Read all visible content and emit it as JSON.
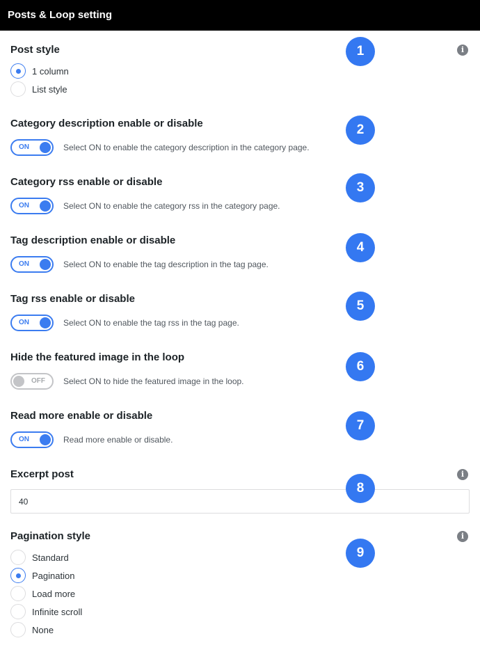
{
  "header": {
    "title": "Posts & Loop setting"
  },
  "info_icon_glyph": "i",
  "post_style": {
    "title": "Post style",
    "badge": "1",
    "options": [
      {
        "label": "1 column",
        "checked": true
      },
      {
        "label": "List style",
        "checked": false
      }
    ]
  },
  "category_description": {
    "title": "Category description enable or disable",
    "badge": "2",
    "toggle": "ON",
    "description": "Select ON to enable the category description in the category page."
  },
  "category_rss": {
    "title": "Category rss enable or disable",
    "badge": "3",
    "toggle": "ON",
    "description": "Select ON to enable the category rss in the category page."
  },
  "tag_description": {
    "title": "Tag description enable or disable",
    "badge": "4",
    "toggle": "ON",
    "description": "Select ON to enable the tag description in the tag page."
  },
  "tag_rss": {
    "title": "Tag rss enable or disable",
    "badge": "5",
    "toggle": "ON",
    "description": "Select ON to enable the tag rss in the tag page."
  },
  "hide_featured_image": {
    "title": "Hide the featured image in the loop",
    "badge": "6",
    "toggle": "OFF",
    "description": "Select ON to hide the featured image in the loop."
  },
  "read_more": {
    "title": "Read more enable or disable",
    "badge": "7",
    "toggle": "ON",
    "description": "Read more enable or disable."
  },
  "excerpt_post": {
    "title": "Excerpt post",
    "badge": "8",
    "value": "40"
  },
  "pagination_style": {
    "title": "Pagination style",
    "badge": "9",
    "options": [
      {
        "label": "Standard",
        "checked": false
      },
      {
        "label": "Pagination",
        "checked": true
      },
      {
        "label": "Load more",
        "checked": false
      },
      {
        "label": "Infinite scroll",
        "checked": false
      },
      {
        "label": "None",
        "checked": false
      }
    ]
  },
  "colors": {
    "accent": "#3b7cf0",
    "badge": "#3478f1",
    "header_bg": "#000000"
  }
}
